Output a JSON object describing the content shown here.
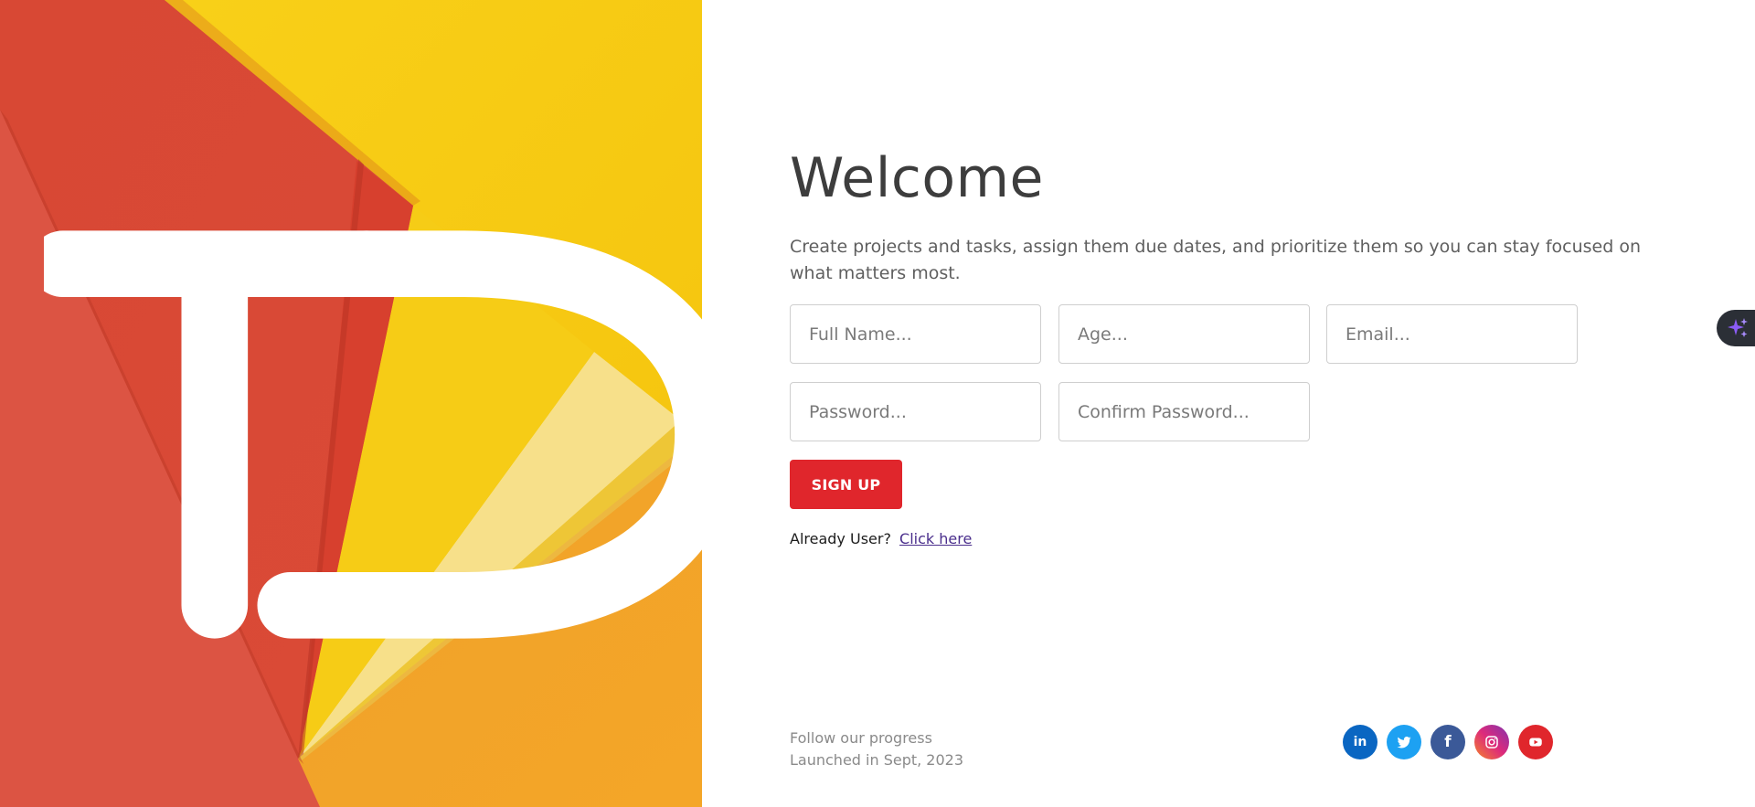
{
  "logo": {
    "icon": "td-logo"
  },
  "header": {
    "title": "Welcome"
  },
  "intro": {
    "text": "Create projects and tasks, assign them due dates, and prioritize them so you can stay focused on what matters most."
  },
  "form": {
    "full_name_placeholder": "Full Name...",
    "age_placeholder": "Age...",
    "email_placeholder": "Email...",
    "password_placeholder": "Password...",
    "confirm_password_placeholder": "Confirm Password...",
    "submit_label": "SIGN UP"
  },
  "login_prompt": {
    "text": "Already User?",
    "link_label": "Click here"
  },
  "footer": {
    "line1": "Follow our progress",
    "line2": "Launched in Sept, 2023",
    "social": [
      {
        "name": "linkedin",
        "label": "in",
        "color": "#0a66c2"
      },
      {
        "name": "twitter",
        "label": "",
        "color": "#1da1f2"
      },
      {
        "name": "facebook",
        "label": "f",
        "color": "#3b5998"
      },
      {
        "name": "instagram",
        "label": "",
        "color": "#c13584"
      },
      {
        "name": "youtube",
        "label": "",
        "color": "#e0262c"
      }
    ]
  },
  "colors": {
    "accent": "#e0262c",
    "yellow": "#f8c80f",
    "orange": "#f3a324",
    "red": "#d94a37"
  }
}
